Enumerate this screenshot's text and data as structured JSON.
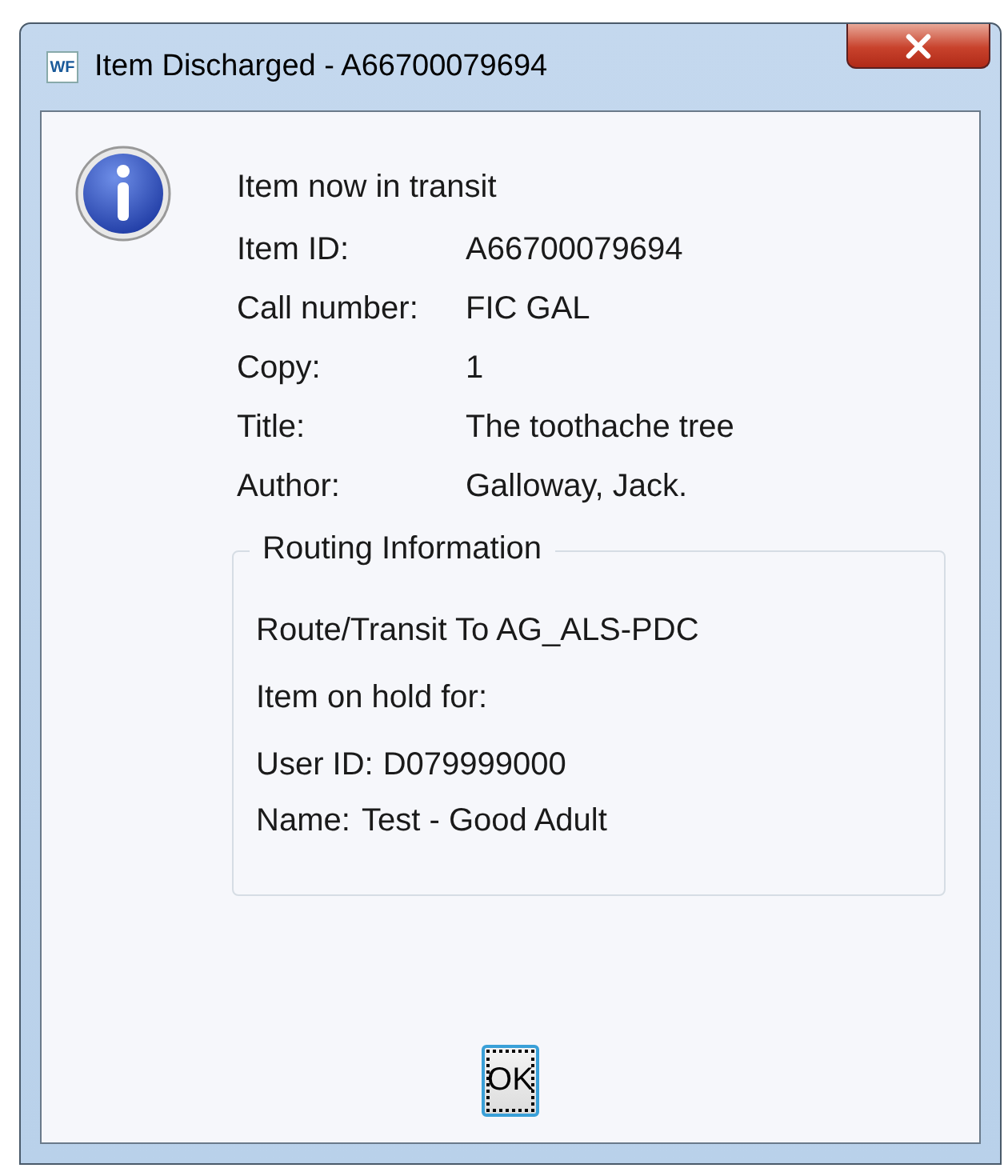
{
  "window": {
    "app_icon": "WF",
    "title": "Item Discharged - A66700079694"
  },
  "message": "Item now in transit",
  "details": [
    {
      "label": "Item ID:",
      "value": "A66700079694"
    },
    {
      "label": "Call number:",
      "value": "FIC GAL"
    },
    {
      "label": "Copy:",
      "value": "1"
    },
    {
      "label": "Title:",
      "value": "The toothache tree"
    },
    {
      "label": "Author:",
      "value": "Galloway, Jack."
    }
  ],
  "routing": {
    "title": "Routing Information",
    "route": "Route/Transit To AG_ALS-PDC",
    "hold": "Item on hold for:",
    "patron": [
      {
        "label": "User ID:",
        "value": "D079999000"
      },
      {
        "label": "Name:",
        "value": "Test - Good Adult"
      }
    ]
  },
  "buttons": [
    {
      "label": "OK",
      "focused": true
    }
  ]
}
